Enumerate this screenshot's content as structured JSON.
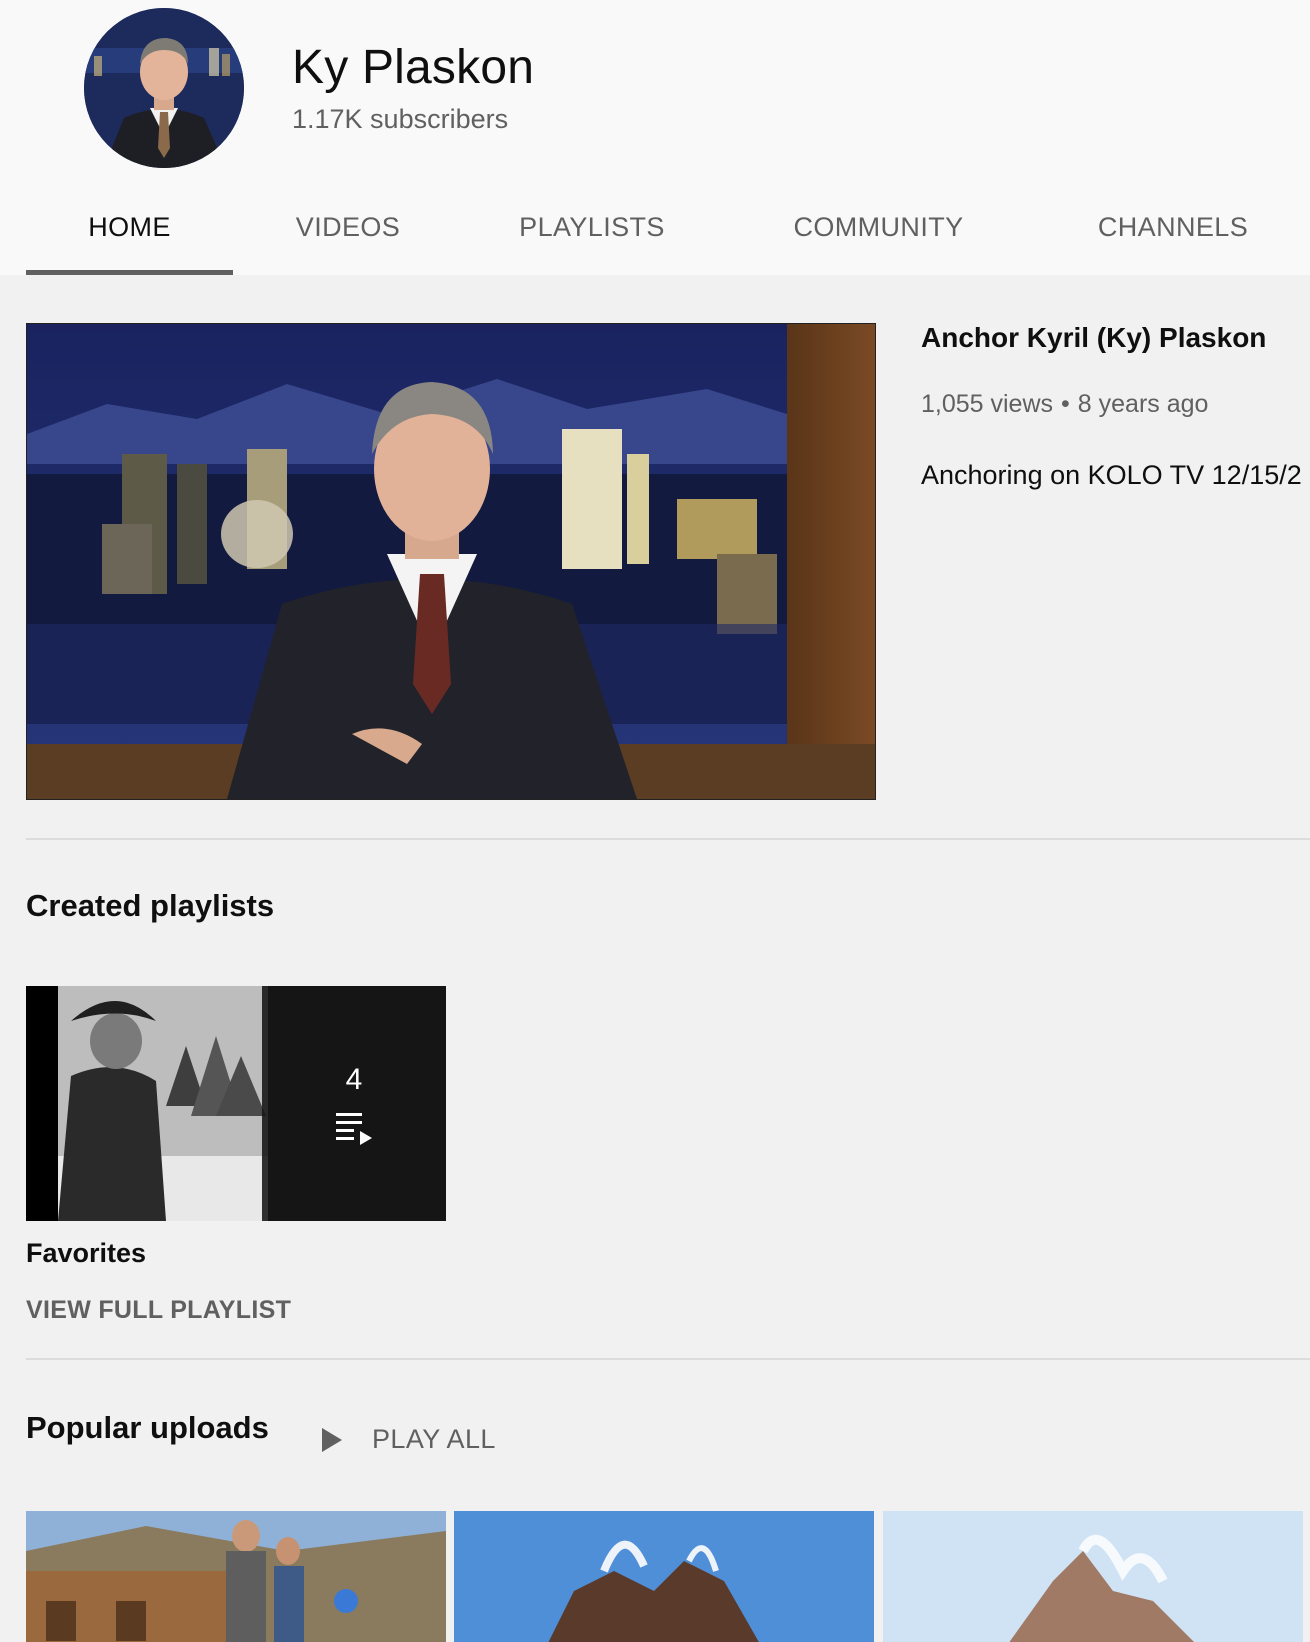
{
  "channel": {
    "name": "Ky Plaskon",
    "subscribers": "1.17K subscribers"
  },
  "tabs": [
    {
      "label": "HOME",
      "active": true
    },
    {
      "label": "VIDEOS",
      "active": false
    },
    {
      "label": "PLAYLISTS",
      "active": false
    },
    {
      "label": "COMMUNITY",
      "active": false
    },
    {
      "label": "CHANNELS",
      "active": false
    }
  ],
  "featured": {
    "title": "Anchor Kyril (Ky) Plaskon",
    "views": "1,055 views",
    "separator": "•",
    "age": "8 years ago",
    "description": "Anchoring on KOLO TV 12/15/2"
  },
  "playlists_section": {
    "title": "Created playlists",
    "items": [
      {
        "title": "Favorites",
        "count": "4",
        "action": "VIEW FULL PLAYLIST",
        "icon": "playlist-play-icon"
      }
    ]
  },
  "popular_section": {
    "title": "Popular uploads",
    "play_all": "PLAY ALL",
    "icon": "play-icon"
  },
  "colors": {
    "page_bg": "#f1f1f1",
    "header_bg": "#f9f9f9",
    "text_primary": "#0f0f0f",
    "text_secondary": "#606060",
    "tab_indicator": "#606060"
  }
}
